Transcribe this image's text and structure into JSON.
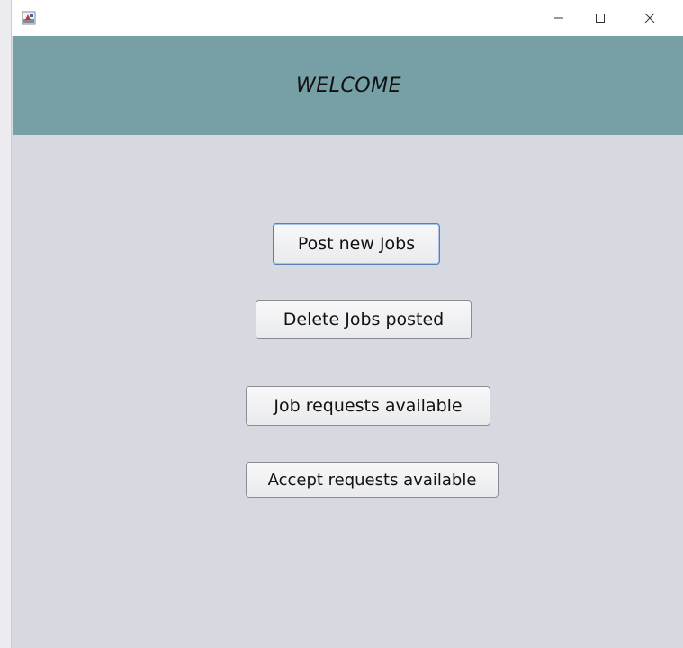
{
  "titlebar": {
    "app_icon": "java-app-icon",
    "minimize_icon": "minimize-icon",
    "maximize_icon": "maximize-icon",
    "close_icon": "close-icon"
  },
  "header": {
    "title": "WELCOME",
    "background_color": "#76a0a6"
  },
  "actions": {
    "post_jobs_label": "Post new Jobs",
    "delete_jobs_label": "Delete Jobs posted",
    "job_requests_label": "Job requests available",
    "accept_requests_label": "Accept requests available"
  },
  "colors": {
    "content_background": "#d6d9e0",
    "focus_border": "#5a7fb8"
  }
}
